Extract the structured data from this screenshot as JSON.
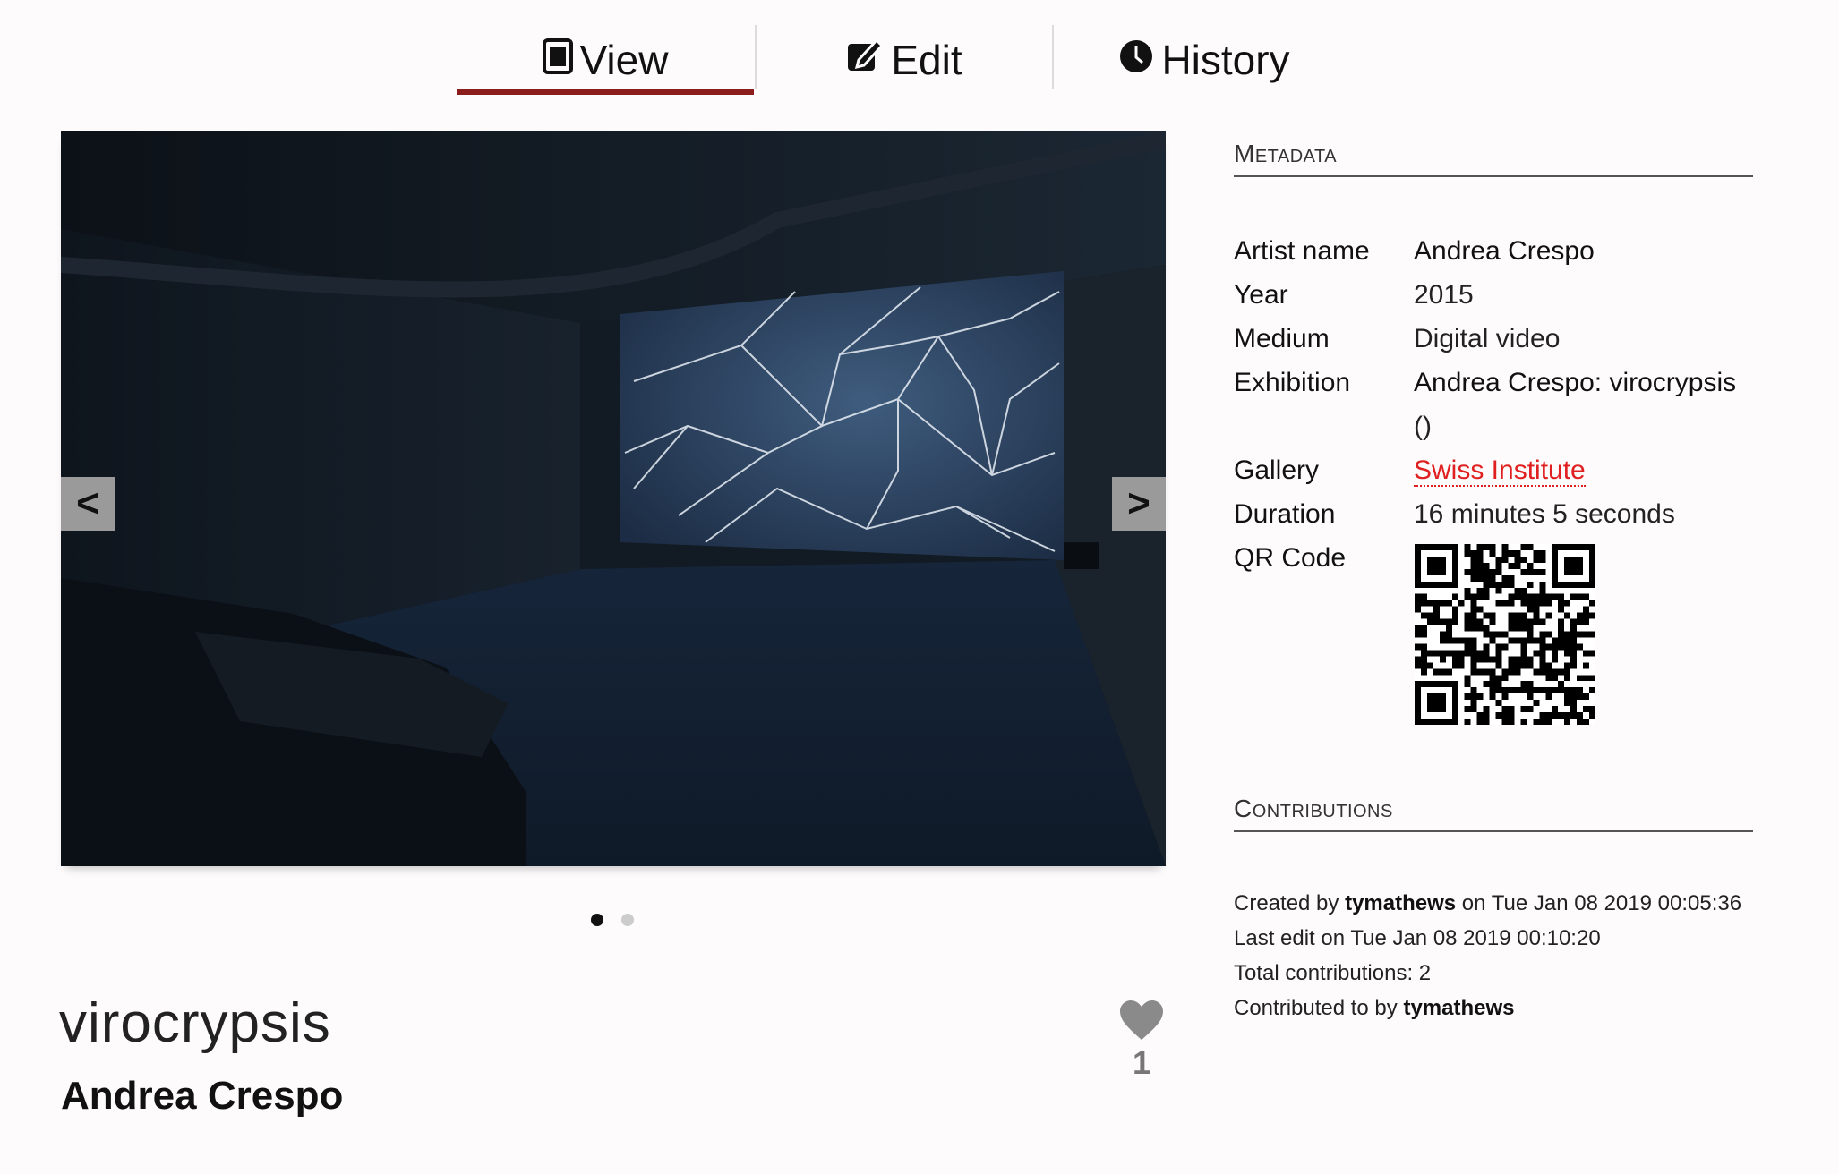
{
  "tabs": {
    "view": "View",
    "edit": "Edit",
    "history": "History"
  },
  "carousel": {
    "prev_label": "<",
    "next_label": ">",
    "slide_count": 2,
    "active_slide": 1
  },
  "artwork": {
    "title": "virocrypsis",
    "artist": "Andrea Crespo",
    "likes": "1"
  },
  "metadata": {
    "heading": "Metadata",
    "artist_label": "Artist name",
    "artist_value": "Andrea Crespo",
    "year_label": "Year",
    "year_value": "2015",
    "medium_label": "Medium",
    "medium_value": "Digital video",
    "exhibition_label": "Exhibition",
    "exhibition_value": "Andrea Crespo: virocrypsis",
    "exhibition_value_2": "()",
    "gallery_label": "Gallery",
    "gallery_value": "Swiss Institute",
    "duration_label": "Duration",
    "duration_value": "16 minutes 5 seconds",
    "qr_label": "QR Code"
  },
  "contributions": {
    "heading": "Contributions",
    "created_prefix": "Created by ",
    "created_user": "tymathews",
    "created_suffix": " on Tue Jan 08 2019 00:05:36",
    "last_edit": "Last edit on Tue Jan 08 2019 00:10:20",
    "total": "Total contributions: 2",
    "contributed_prefix": "Contributed to by ",
    "contributed_user": "tymathews"
  },
  "colors": {
    "tab_underline": "#8c1d1d",
    "link_red": "#e02020",
    "background": "#fdfbfb"
  },
  "icons": {
    "view": "tablet-icon",
    "edit": "edit-icon",
    "history": "clock-icon",
    "like": "heart-icon"
  }
}
